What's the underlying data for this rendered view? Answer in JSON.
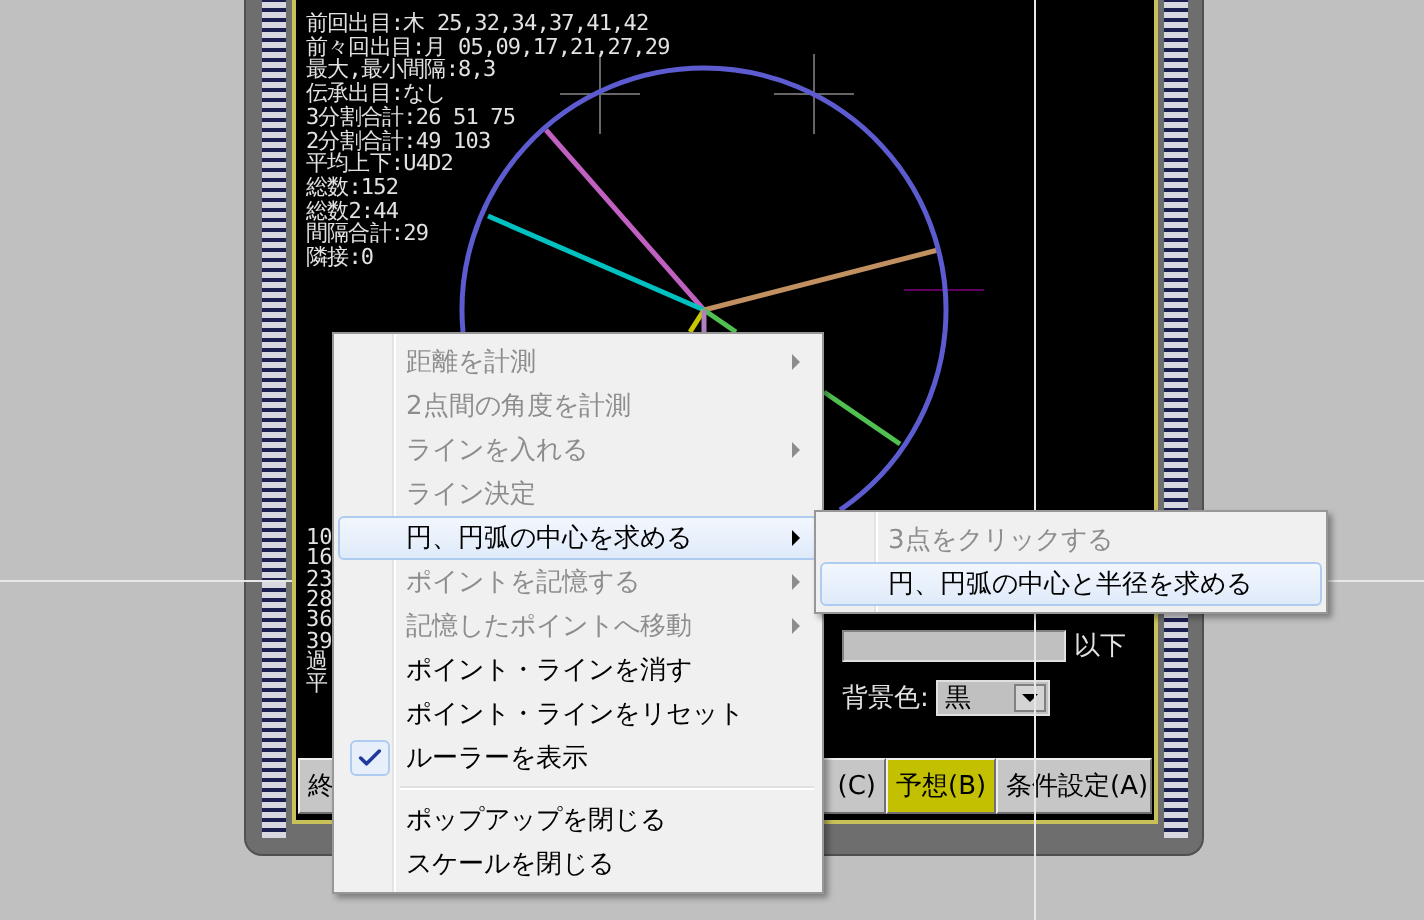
{
  "stats_lines": [
    "前回出目:木 25,32,34,37,41,42",
    "前々回出目:月 05,09,17,21,27,29",
    "最大,最小間隔:8,3",
    "伝承出目:なし",
    "3分割合計:26 51 75",
    "2分割合計:49 103",
    "平均上下:U4D2",
    "総数:152",
    "総数2:44",
    "間隔合計:29",
    "隣接:0"
  ],
  "partial_lines": [
    "10",
    "16",
    "23",
    "28",
    "36",
    "39",
    "過",
    "平"
  ],
  "form": {
    "suffix": "以下",
    "background_label": "背景色:",
    "background_value": "黒"
  },
  "buttons": [
    {
      "label": "終",
      "active": false
    },
    {
      "label": "(C)",
      "active": false
    },
    {
      "label": "予想(B)",
      "active": true
    },
    {
      "label": "条件設定(A)",
      "active": false
    }
  ],
  "context_menu": {
    "items": [
      {
        "kind": "item",
        "label": "距離を計測",
        "disabled": true,
        "submenu": true,
        "checked": false,
        "selected": false
      },
      {
        "kind": "item",
        "label": "2点間の角度を計測",
        "disabled": true,
        "submenu": false,
        "checked": false,
        "selected": false
      },
      {
        "kind": "item",
        "label": "ラインを入れる",
        "disabled": true,
        "submenu": true,
        "checked": false,
        "selected": false
      },
      {
        "kind": "item",
        "label": "ライン決定",
        "disabled": true,
        "submenu": false,
        "checked": false,
        "selected": false
      },
      {
        "kind": "item",
        "label": "円、円弧の中心を求める",
        "disabled": false,
        "submenu": true,
        "checked": false,
        "selected": true
      },
      {
        "kind": "item",
        "label": "ポイントを記憶する",
        "disabled": true,
        "submenu": true,
        "checked": false,
        "selected": false
      },
      {
        "kind": "item",
        "label": "記憶したポイントへ移動",
        "disabled": true,
        "submenu": true,
        "checked": false,
        "selected": false
      },
      {
        "kind": "item",
        "label": "ポイント・ラインを消す",
        "disabled": false,
        "submenu": false,
        "checked": false,
        "selected": false
      },
      {
        "kind": "item",
        "label": "ポイント・ラインをリセット",
        "disabled": false,
        "submenu": false,
        "checked": false,
        "selected": false
      },
      {
        "kind": "item",
        "label": "ルーラーを表示",
        "disabled": false,
        "submenu": false,
        "checked": true,
        "selected": false
      },
      {
        "kind": "separator"
      },
      {
        "kind": "item",
        "label": "ポップアップを閉じる",
        "disabled": false,
        "submenu": false,
        "checked": false,
        "selected": false
      },
      {
        "kind": "item",
        "label": "スケールを閉じる",
        "disabled": false,
        "submenu": false,
        "checked": false,
        "selected": false
      }
    ]
  },
  "submenu": {
    "items": [
      {
        "kind": "item",
        "label": "3点をクリックする",
        "disabled": true,
        "submenu": false,
        "checked": false,
        "selected": false
      },
      {
        "kind": "item",
        "label": "円、円弧の中心と半径を求める",
        "disabled": false,
        "submenu": false,
        "checked": false,
        "selected": true
      }
    ]
  }
}
